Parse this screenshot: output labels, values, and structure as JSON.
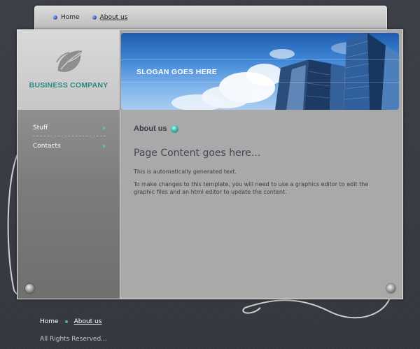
{
  "top_nav": {
    "items": [
      {
        "label": "Home",
        "active": false
      },
      {
        "label": "About us",
        "active": true
      }
    ]
  },
  "brand": {
    "company_name": "BUSINESS COMPANY",
    "slogan": "SLOGAN GOES HERE"
  },
  "sidebar": {
    "items": [
      {
        "label": "Stuff"
      },
      {
        "label": "Contacts"
      }
    ]
  },
  "main": {
    "section_title": "About us",
    "heading": "Page Content goes here...",
    "paragraphs": [
      "This is automatically generated text.",
      "To make changes to this template, you will need to use a graphics editor to edit the graphic files and an html editor to update the content."
    ]
  },
  "footer": {
    "nav": [
      {
        "label": "Home",
        "active": false
      },
      {
        "label": "About us",
        "active": true
      }
    ],
    "copyright": "All Rights Reserved..."
  },
  "colors": {
    "accent_teal": "#2a8a80",
    "nav_dot_blue": "#3557b8",
    "page_bg": "#3a3d45",
    "content_bg": "#a9a9a9"
  },
  "icons": [
    "leaf-logo-icon",
    "bullet-dot-icon",
    "arrow-right-icon",
    "screw-icon"
  ]
}
